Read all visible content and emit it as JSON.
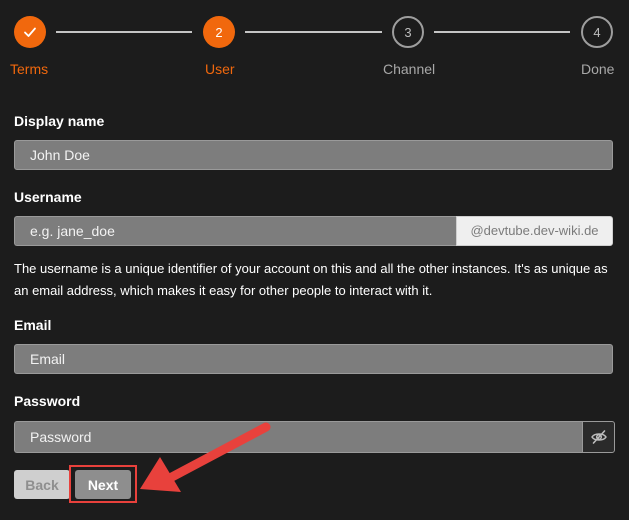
{
  "stepper": {
    "steps": [
      {
        "label": "Terms",
        "number": "",
        "state": "done"
      },
      {
        "label": "User",
        "number": "2",
        "state": "active"
      },
      {
        "label": "Channel",
        "number": "3",
        "state": "pending"
      },
      {
        "label": "Done",
        "number": "4",
        "state": "pending"
      }
    ],
    "colors": {
      "active": "#f1680d",
      "pending": "#9e9e9e"
    }
  },
  "form": {
    "display_name": {
      "label": "Display name",
      "value": "John Doe"
    },
    "username": {
      "label": "Username",
      "placeholder": "e.g. jane_doe",
      "suffix": "@devtube.dev-wiki.de",
      "help": "The username is a unique identifier of your account on this and all the other instances. It's as unique as an email address, which makes it easy for other people to interact with it."
    },
    "email": {
      "label": "Email",
      "placeholder": "Email"
    },
    "password": {
      "label": "Password",
      "placeholder": "Password",
      "toggle_icon": "eye-slash-icon"
    }
  },
  "buttons": {
    "back_label": "Back",
    "next_label": "Next"
  },
  "annotation": {
    "highlight_color": "#e8413c",
    "arrow_icon": "red-arrow-pointer"
  }
}
